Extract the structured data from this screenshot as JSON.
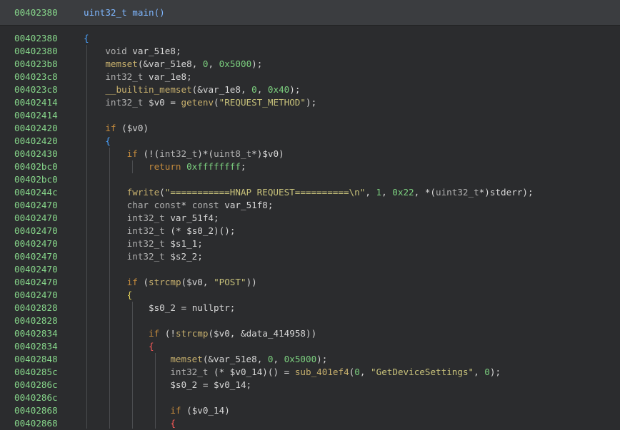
{
  "header": {
    "address": "00402380",
    "signature": "uint32_t main()"
  },
  "lines": [
    {
      "address": "00402380",
      "src": "{"
    },
    {
      "address": "00402380",
      "src": "    void var_51e8;"
    },
    {
      "address": "004023b8",
      "src": "    memset(&var_51e8, 0, 0x5000);"
    },
    {
      "address": "004023c8",
      "src": "    int32_t var_1e8;"
    },
    {
      "address": "004023c8",
      "src": "    __builtin_memset(&var_1e8, 0, 0x40);"
    },
    {
      "address": "00402414",
      "src": "    int32_t $v0 = getenv(\"REQUEST_METHOD\");"
    },
    {
      "address": "00402414",
      "src": ""
    },
    {
      "address": "00402420",
      "src": "    if ($v0)"
    },
    {
      "address": "00402420",
      "src": "    {"
    },
    {
      "address": "00402430",
      "src": "        if (!(int32_t)*(uint8_t*)$v0)"
    },
    {
      "address": "00402bc0",
      "src": "            return 0xffffffff;"
    },
    {
      "address": "00402bc0",
      "src": ""
    },
    {
      "address": "0040244c",
      "src": "        fwrite(\"===========HNAP REQUEST==========\\n\", 1, 0x22, *(uint32_t*)stderr);"
    },
    {
      "address": "00402470",
      "src": "        char const* const var_51f8;"
    },
    {
      "address": "00402470",
      "src": "        int32_t var_51f4;"
    },
    {
      "address": "00402470",
      "src": "        int32_t (* $s0_2)();"
    },
    {
      "address": "00402470",
      "src": "        int32_t $s1_1;"
    },
    {
      "address": "00402470",
      "src": "        int32_t $s2_2;"
    },
    {
      "address": "00402470",
      "src": ""
    },
    {
      "address": "00402470",
      "src": "        if (strcmp($v0, \"POST\"))"
    },
    {
      "address": "00402470",
      "src": "        {"
    },
    {
      "address": "00402828",
      "src": "            $s0_2 = nullptr;"
    },
    {
      "address": "00402828",
      "src": ""
    },
    {
      "address": "00402834",
      "src": "            if (!strcmp($v0, &data_414958))"
    },
    {
      "address": "00402834",
      "src": "            {"
    },
    {
      "address": "00402848",
      "src": "                memset(&var_51e8, 0, 0x5000);"
    },
    {
      "address": "0040285c",
      "src": "                int32_t (* $v0_14)() = sub_401ef4(0, \"GetDeviceSettings\", 0);"
    },
    {
      "address": "0040286c",
      "src": "                $s0_2 = $v0_14;"
    },
    {
      "address": "0040286c",
      "src": ""
    },
    {
      "address": "00402868",
      "src": "                if ($v0_14)"
    },
    {
      "address": "00402868",
      "src": "                {"
    }
  ]
}
